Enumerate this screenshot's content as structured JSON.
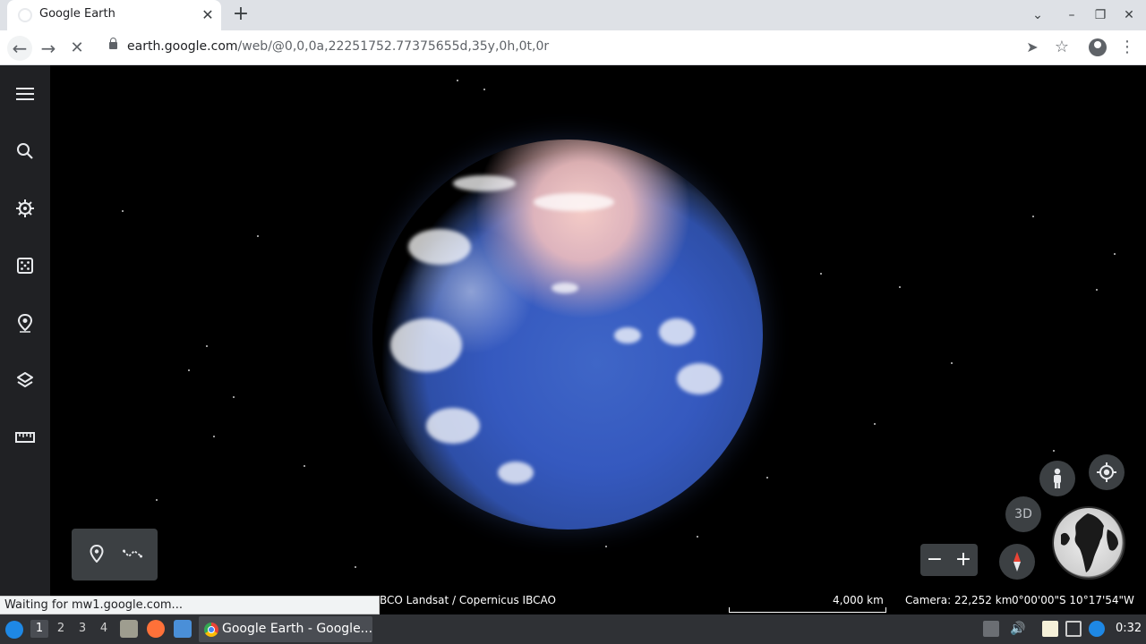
{
  "browser": {
    "tab": {
      "title": "Google Earth"
    },
    "omnibox": {
      "host": "earth.google.com",
      "path": "/web/@0,0,0a,22251752.77375655d,35y,0h,0t,0r"
    }
  },
  "earth": {
    "attribution": "BCO  Landsat / Copernicus  IBCAO",
    "scale_label": "4,000 km",
    "camera": "Camera: 22,252 km",
    "coordinates": "0°00'00\"S 10°17'54\"W",
    "view_mode_label": "3D"
  },
  "status_text": "Waiting for mw1.google.com...",
  "taskbar": {
    "workspaces": [
      "1",
      "2",
      "3",
      "4"
    ],
    "active_task_label": "Google Earth - Google...",
    "clock": "0:32"
  },
  "icons": {
    "sidebar": [
      "menu-icon",
      "search-icon",
      "voyager-icon",
      "feeling-lucky-icon",
      "projects-icon",
      "map-style-icon",
      "measure-icon"
    ],
    "map_tools": [
      "add-placemark-icon",
      "draw-path-icon"
    ],
    "map_controls": [
      "pegman-icon",
      "my-location-icon",
      "compass-icon",
      "zoom-out-icon",
      "zoom-in-icon",
      "globe-icon"
    ]
  }
}
